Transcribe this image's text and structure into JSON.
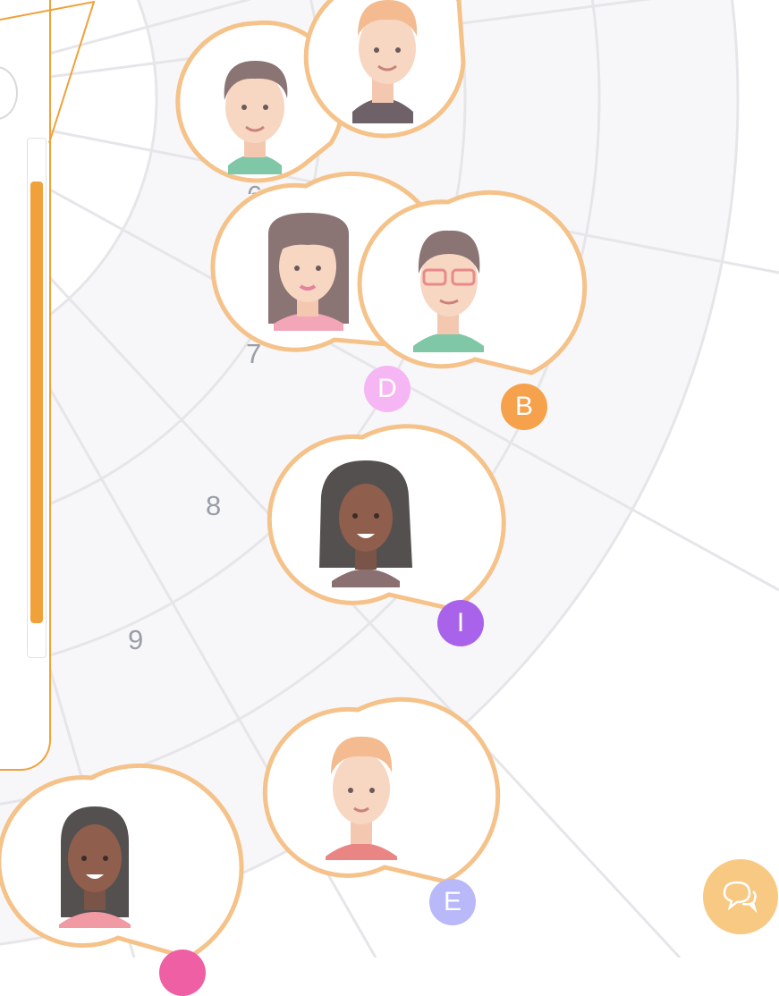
{
  "colors": {
    "accent": "#f0a13a",
    "bubble_border": "#f5c28a",
    "ring_bg": "#f7f7f9",
    "ring_line": "#e6e6ea",
    "badge_B": "#f6a14b",
    "badge_D": "#f6b6f3",
    "badge_I": "#a963ea",
    "badge_E": "#b9b8f8",
    "chat_button": "#f8c983"
  },
  "rings": {
    "labels": [
      "6",
      "7",
      "8",
      "9"
    ]
  },
  "participants": [
    {
      "badge": "",
      "avatar": "man-brown-hair-green-collar-avatar"
    },
    {
      "badge": "",
      "avatar": "man-blonde-dark-jacket-avatar"
    },
    {
      "badge": "D",
      "avatar": "woman-bangs-pink-top-avatar"
    },
    {
      "badge": "B",
      "avatar": "man-glasses-green-shirt-avatar"
    },
    {
      "badge": "I",
      "avatar": "woman-curly-dark-hair-avatar"
    },
    {
      "badge": "E",
      "avatar": "man-blonde-red-jacket-avatar"
    },
    {
      "badge": "",
      "avatar": "woman-long-dark-hair-avatar"
    }
  ],
  "chat": {
    "icon": "chat-bubbles-icon"
  },
  "sidebar": {
    "icon": "round-button-icon"
  }
}
